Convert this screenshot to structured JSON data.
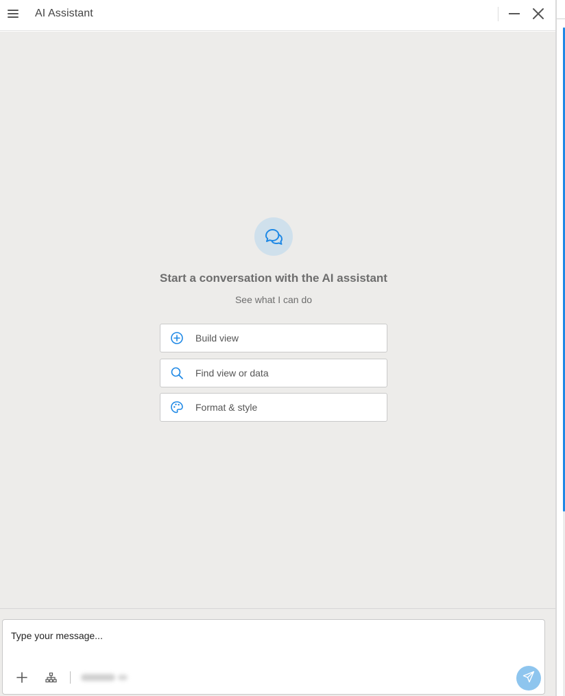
{
  "header": {
    "title": "AI Assistant",
    "menu_icon": "hamburger-menu-icon",
    "minimize_icon": "minimize-icon",
    "close_icon": "close-icon"
  },
  "empty_state": {
    "icon": "chat-bubbles-icon",
    "title": "Start a conversation with the AI assistant",
    "subtitle": "See what I can do",
    "actions": [
      {
        "label": "Build view",
        "icon": "plus-circle-icon"
      },
      {
        "label": "Find view or data",
        "icon": "search-icon"
      },
      {
        "label": "Format & style",
        "icon": "palette-icon"
      }
    ]
  },
  "composer": {
    "placeholder": "Type your message...",
    "add_icon": "plus-icon",
    "data_source_icon": "hierarchy-icon",
    "send_icon": "send-icon"
  },
  "colors": {
    "accent": "#1e88e5",
    "send_button": "#8ec5ee",
    "hero_circle": "#cfe0ec",
    "main_background": "#edecea"
  }
}
